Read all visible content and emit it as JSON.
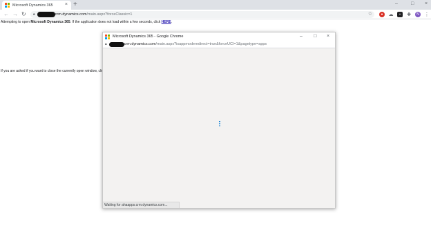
{
  "browser": {
    "tab_title": "Microsoft Dynamics 365",
    "tab_close": "×",
    "new_tab": "+",
    "url_host": "crm.dynamics.com",
    "url_path": "/main.aspx?forceClassic=1",
    "controls": {
      "minimize": "–",
      "maximize": "□",
      "close": "×"
    }
  },
  "page": {
    "message_prefix": "Attempting to open ",
    "message_bold": "Microsoft Dynamics 365",
    "message_suffix": ". If the application does not load within a few seconds, click ",
    "here_link": "HERE",
    "message_end": ".",
    "second_message": "If you are asked if you want to close the currently open window, click"
  },
  "popup": {
    "title": "Microsoft Dynamics 365 - Google Chrome",
    "url_host": "crm.dynamics.com",
    "url_path": "/main.aspx?isappmoderedirect=true&forceUCI=1&pagetype=apps",
    "status": "Waiting for ahaapps.crm.dynamics.com...",
    "controls": {
      "minimize": "–",
      "maximize": "□",
      "close": "×"
    }
  },
  "colors": {
    "ms_red": "#f25022",
    "ms_green": "#7fba00",
    "ms_blue": "#00a4ef",
    "ms_yellow": "#ffb900",
    "spinner": "#0078d4",
    "link": "#1a0dab"
  }
}
